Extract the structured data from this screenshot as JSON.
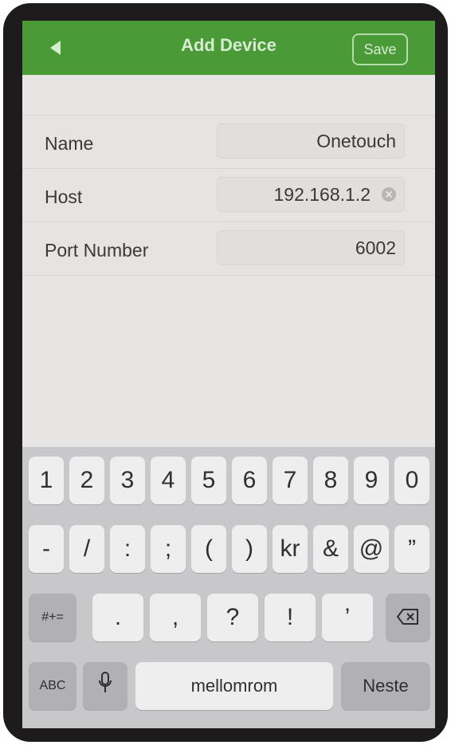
{
  "navbar": {
    "title": "Add Device",
    "save_label": "Save",
    "back_icon": "back-arrow-icon",
    "color": "#4a9a37"
  },
  "form": {
    "rows": [
      {
        "label": "Name",
        "value": "Onetouch"
      },
      {
        "label": "Host",
        "value": "192.168.1.2"
      },
      {
        "label": "Port Number",
        "value": "6002"
      }
    ]
  },
  "keyboard": {
    "row1": [
      "1",
      "2",
      "3",
      "4",
      "5",
      "6",
      "7",
      "8",
      "9",
      "0"
    ],
    "row2": [
      "-",
      "/",
      ":",
      ";",
      "(",
      ")",
      "kr",
      "&",
      "@",
      "”"
    ],
    "row3": {
      "toggle": "#+=",
      "keys": [
        ".",
        ",",
        "?",
        "!",
        "’"
      ],
      "delete_icon": "backspace-icon"
    },
    "row4": {
      "mode": "ABC",
      "mic_icon": "microphone-icon",
      "space": "mellomrom",
      "next": "Neste"
    }
  }
}
